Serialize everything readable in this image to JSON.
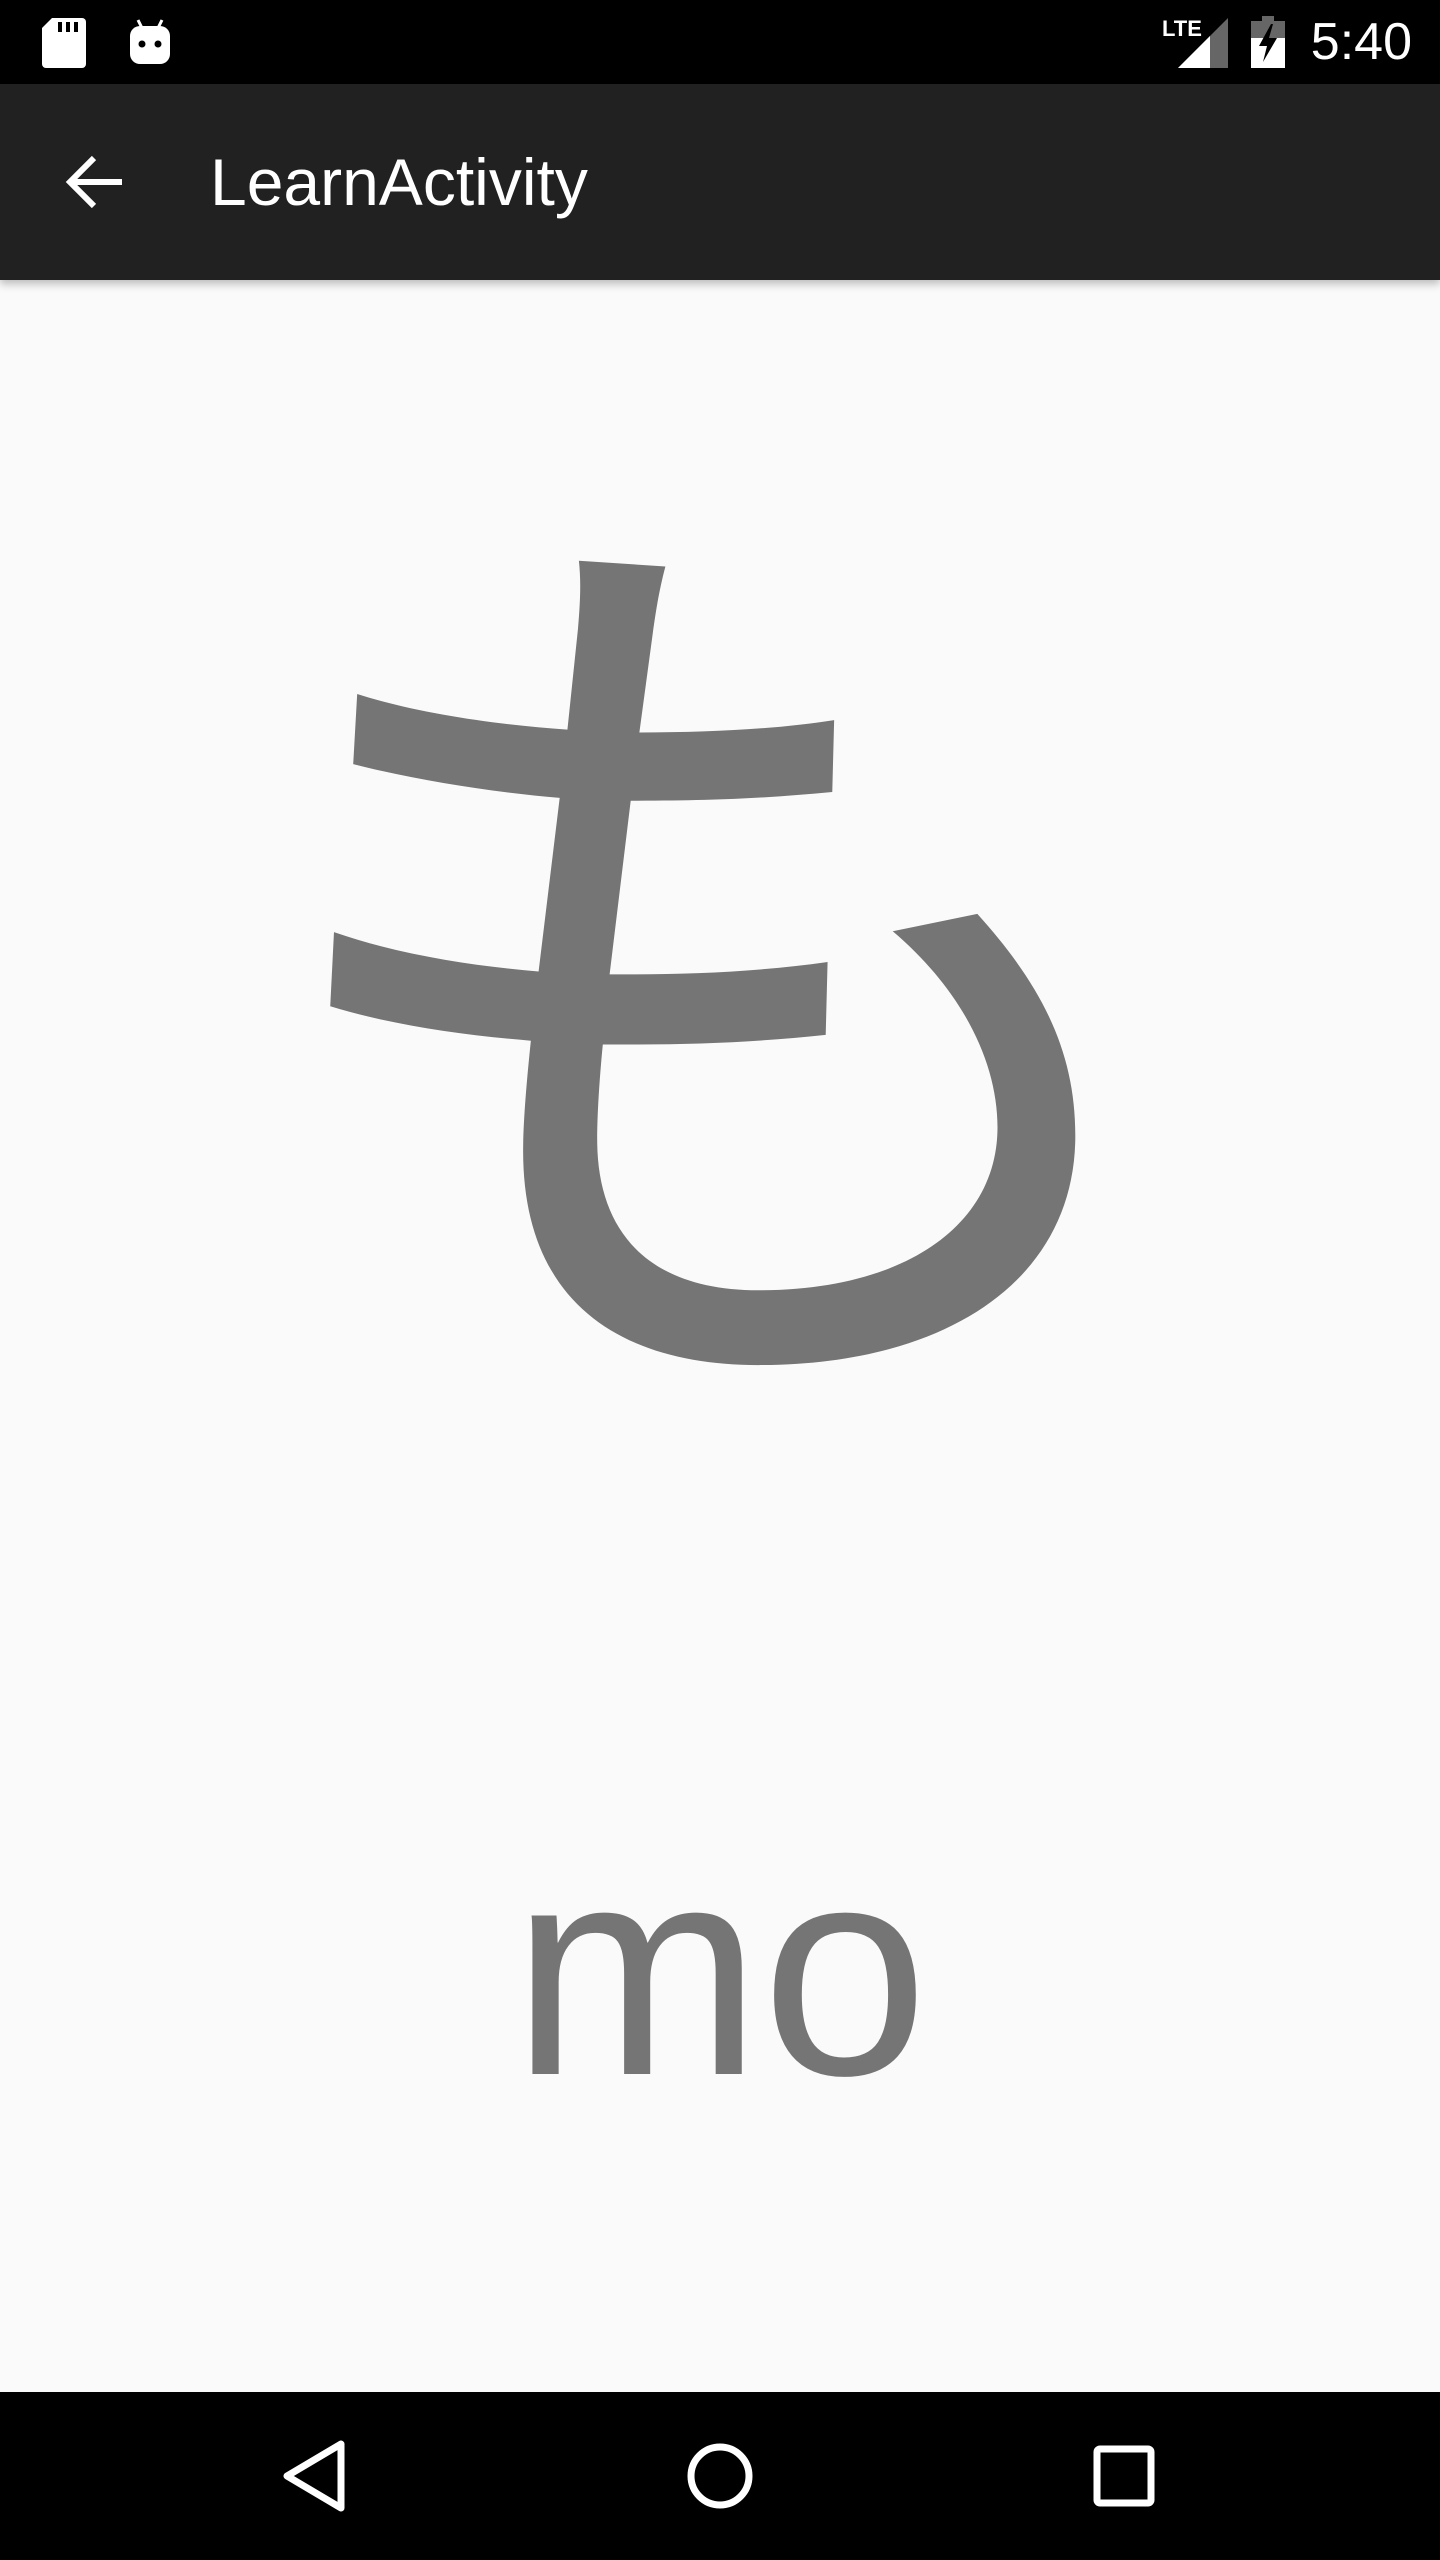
{
  "status_bar": {
    "time": "5:40",
    "network_label": "LTE",
    "icons": [
      "sd-card-icon",
      "android-icon",
      "lte-signal-icon",
      "battery-charging-icon"
    ]
  },
  "app_bar": {
    "title": "LearnActivity",
    "back_icon": "arrow-back-icon"
  },
  "card": {
    "character": "も",
    "romaji": "mo"
  },
  "nav_bar": {
    "icons": [
      "nav-back-icon",
      "nav-home-icon",
      "nav-recents-icon"
    ]
  },
  "colors": {
    "status_bar": "#000000",
    "app_bar": "#212121",
    "background": "#fafafa",
    "glyph": "#757575",
    "nav_bar": "#000000"
  }
}
